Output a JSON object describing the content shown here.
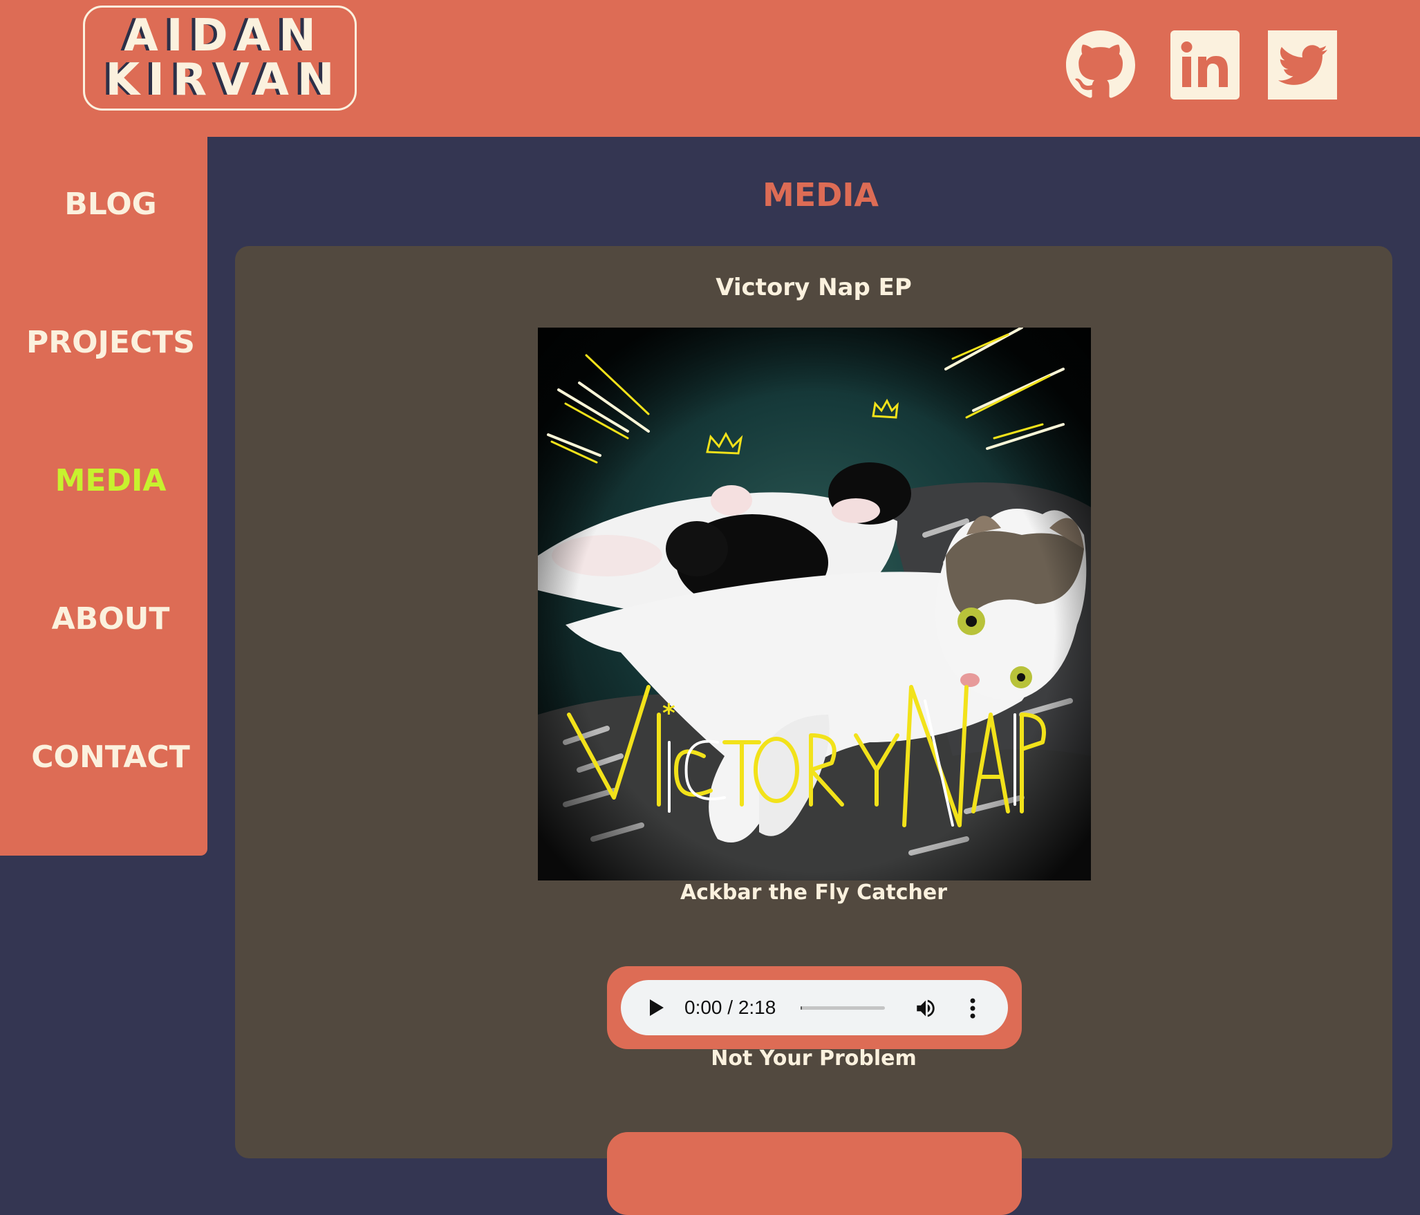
{
  "site": {
    "logo_line1": "AIDAN",
    "logo_line2": "KIRVAN"
  },
  "social": [
    {
      "name": "github",
      "icon": "github-icon"
    },
    {
      "name": "linkedin",
      "icon": "linkedin-icon"
    },
    {
      "name": "twitter",
      "icon": "twitter-icon"
    }
  ],
  "nav": {
    "items": [
      {
        "label": "BLOG",
        "active": false
      },
      {
        "label": "PROJECTS",
        "active": false
      },
      {
        "label": "MEDIA",
        "active": true
      },
      {
        "label": "ABOUT",
        "active": false
      },
      {
        "label": "CONTACT",
        "active": false
      }
    ]
  },
  "main": {
    "page_title": "MEDIA",
    "album_title": "Victory Nap EP",
    "cover_art_text": "VICTORY NAP",
    "tracks": [
      {
        "title": "Ackbar the Fly Catcher",
        "time": "0:00 / 2:18",
        "progress": 0.0
      },
      {
        "title": "Not Your Problem"
      }
    ]
  },
  "colors": {
    "accent": "#dd6c55",
    "background": "#343652",
    "panel": "#52493f",
    "cream": "#fbf1de",
    "active_nav": "#c7f22e"
  }
}
